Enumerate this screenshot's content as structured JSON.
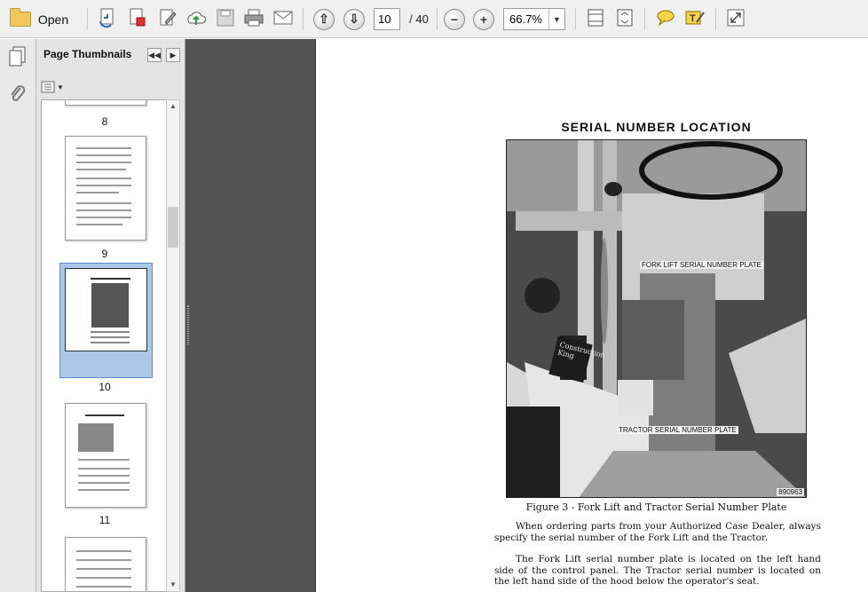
{
  "toolbar": {
    "open_label": "Open",
    "current_page": "10",
    "page_total": "/ 40",
    "zoom": "66.7%",
    "icons": [
      "folder-icon",
      "create-pdf-icon",
      "convert-icon",
      "edit-icon",
      "upload-icon",
      "save-icon",
      "print-icon",
      "email-icon",
      "previous-page-icon",
      "next-page-icon",
      "zoom-out-icon",
      "zoom-in-icon",
      "zoom-dropdown-icon",
      "fit-width-icon",
      "fit-page-icon",
      "comment-icon",
      "highlight-icon",
      "fullscreen-icon"
    ]
  },
  "sidebar": {
    "panel_title": "Page Thumbnails",
    "thumbnails": [
      {
        "label": "8"
      },
      {
        "label": "9"
      },
      {
        "label": "10",
        "selected": true
      },
      {
        "label": "11"
      }
    ]
  },
  "document": {
    "title": "SERIAL NUMBER LOCATION",
    "photo_labels": {
      "fork_lift": "FORK LIFT SERIAL NUMBER PLATE",
      "tractor": "TRACTOR SERIAL NUMBER PLATE",
      "photo_number": "890963",
      "brand": "Construction King"
    },
    "figure_caption": "Figure 3 - Fork Lift and Tractor Serial Number Plate",
    "paragraphs": [
      "When ordering parts from your Authorized Case Dealer, always specify the serial number of the Fork Lift and the Tractor.",
      "The Fork Lift serial number plate is located on the left hand side of the control panel. The Tractor serial number is located on the left hand side of the hood below the operator's seat."
    ]
  }
}
